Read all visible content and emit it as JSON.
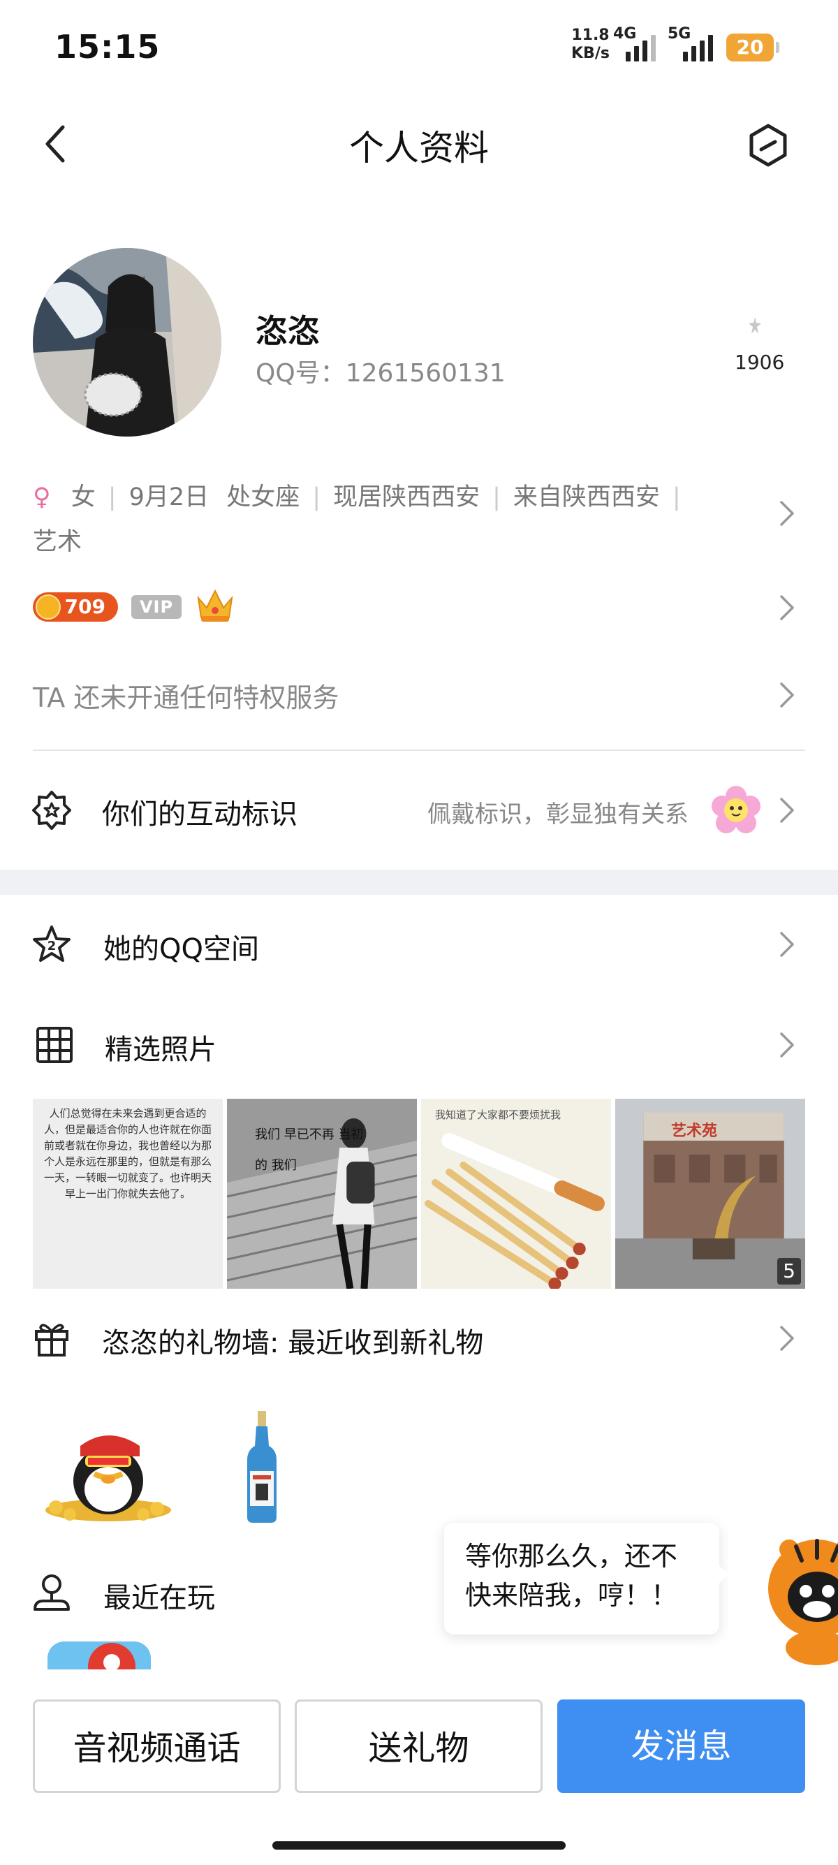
{
  "status_bar": {
    "time": "15:15",
    "speed_value": "11.8",
    "speed_unit": "KB/s",
    "net1": "4G",
    "net2": "5G",
    "battery": "20"
  },
  "header": {
    "title": "个人资料"
  },
  "profile": {
    "name": "恣恣",
    "qq_label": "QQ号：",
    "qq_number": "1261560131",
    "likes": "1906",
    "gender_symbol": "♀",
    "gender": "女",
    "birthday": "9月2日",
    "zodiac": "处女座",
    "location": "现居陕西西安",
    "hometown": "来自陕西西安",
    "profession": "艺术",
    "level": "709",
    "vip_label": "VIP",
    "privilege_text": "TA 还未开通任何特权服务"
  },
  "interaction": {
    "label": "你们的互动标识",
    "hint": "佩戴标识，彰显独有关系"
  },
  "qzone": {
    "label": "她的QQ空间"
  },
  "photos": {
    "label": "精选照片",
    "count": "5",
    "items": [
      {
        "text": "人们总觉得在未来会遇到更合适的人，但是最适合你的人也许就在你面前或者就在你身边，我也曾经以为那个人是永远在那里的，但就是有那么一天，一转眼一切就变了。也许明天早上一出门你就失去他了。"
      },
      {
        "text": "我们 早已不再 当初的 我们"
      },
      {
        "text": "我知道了大家都不要烦扰我"
      },
      {
        "text": "艺术苑"
      }
    ]
  },
  "gifts": {
    "label": "恣恣的礼物墙: 最近收到新礼物"
  },
  "recent": {
    "label": "最近在玩"
  },
  "bubble": {
    "line1": "等你那么久，还不",
    "line2": "快来陪我，哼！！"
  },
  "actions": {
    "call": "音视频通话",
    "gift": "送礼物",
    "message": "发消息"
  },
  "colors": {
    "accent": "#3f8ef2",
    "gender": "#e96fa0",
    "level_badge": "#e8541e",
    "vip_badge": "#b8b8b8",
    "battery": "#f1a535"
  }
}
